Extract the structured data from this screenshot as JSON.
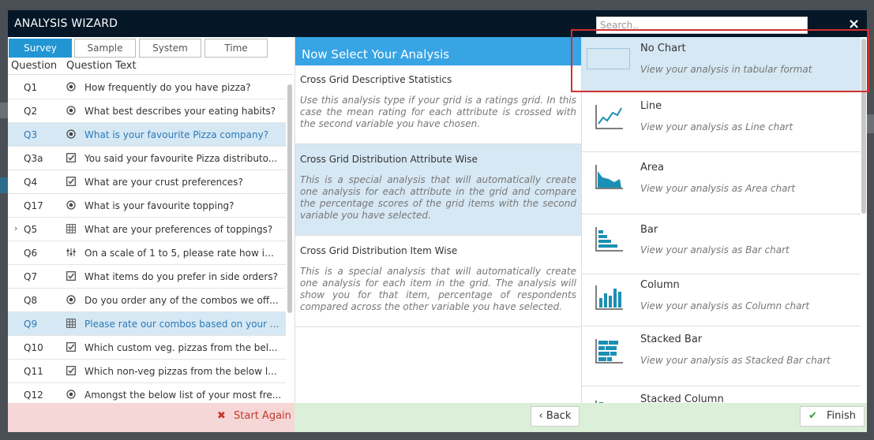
{
  "window": {
    "title": "ANALYSIS WIZARD",
    "close": "×"
  },
  "search": {
    "placeholder": "Search.."
  },
  "tabs": [
    {
      "label": "Survey",
      "active": true
    },
    {
      "label": "Sample",
      "active": false
    },
    {
      "label": "System",
      "active": false
    },
    {
      "label": "Time",
      "active": false
    }
  ],
  "question_list": {
    "headers": {
      "question": "Question",
      "text": "Question Text"
    },
    "rows": [
      {
        "id": "Q1",
        "icon": "radio-icon",
        "text": "How frequently do you have pizza?",
        "selected": false,
        "caret": ""
      },
      {
        "id": "Q2",
        "icon": "radio-icon",
        "text": "What best describes your eating habits?",
        "selected": false,
        "caret": ""
      },
      {
        "id": "Q3",
        "icon": "radio-icon",
        "text": "What is your favourite Pizza company?",
        "selected": true,
        "caret": ""
      },
      {
        "id": "Q3a",
        "icon": "checkbox-icon",
        "text": "You said your favourite Pizza distributo...",
        "selected": false,
        "caret": ""
      },
      {
        "id": "Q4",
        "icon": "checkbox-icon",
        "text": "What are your crust preferences?",
        "selected": false,
        "caret": ""
      },
      {
        "id": "Q17",
        "icon": "radio-icon",
        "text": "What is your favourite topping?",
        "selected": false,
        "caret": ""
      },
      {
        "id": "Q5",
        "icon": "grid-icon",
        "text": "What are your preferences of toppings?",
        "selected": false,
        "caret": "›"
      },
      {
        "id": "Q6",
        "icon": "sliders-icon",
        "text": "On a scale of 1 to 5, please rate how im...",
        "selected": false,
        "caret": ""
      },
      {
        "id": "Q7",
        "icon": "checkbox-icon",
        "text": "What items do you prefer in side orders?",
        "selected": false,
        "caret": ""
      },
      {
        "id": "Q8",
        "icon": "radio-icon",
        "text": "Do you order any of the combos we off...",
        "selected": false,
        "caret": ""
      },
      {
        "id": "Q9",
        "icon": "grid-icon",
        "text": "Please rate our combos based on your ...",
        "selected": true,
        "caret": ""
      },
      {
        "id": "Q10",
        "icon": "checkbox-icon",
        "text": "Which custom veg. pizzas from the bel...",
        "selected": false,
        "caret": ""
      },
      {
        "id": "Q11",
        "icon": "checkbox-icon",
        "text": "Which non-veg pizzas from the below l...",
        "selected": false,
        "caret": ""
      },
      {
        "id": "Q12",
        "icon": "radio-icon",
        "text": "Amongst the below list of your most fre...",
        "selected": false,
        "caret": ""
      }
    ]
  },
  "analysis": {
    "heading": "Now Select Your Analysis",
    "items": [
      {
        "title": "Cross Grid Descriptive Statistics",
        "description": "Use this analysis type if your grid is a ratings grid. In this case the mean rating for each attribute is crossed with the second variable you have chosen.",
        "selected": false
      },
      {
        "title": "Cross Grid Distribution Attribute Wise",
        "description": "This is a special analysis that will automatically create one analysis for each attribute in the grid and compare the percentage scores of the grid items with the second variable you have selected.",
        "selected": true
      },
      {
        "title": "Cross Grid Distribution Item Wise",
        "description": "This is a special analysis that will automatically create one analysis for each item in the grid. The analysis will show you for that item, percentage of respondents compared across the other variable you have selected.",
        "selected": false
      }
    ]
  },
  "charts": [
    {
      "name": "No Chart",
      "description": "View your analysis in tabular format",
      "icon": "no-chart-icon",
      "selected": true
    },
    {
      "name": "Line",
      "description": "View your analysis as Line chart",
      "icon": "line-chart-icon",
      "selected": false
    },
    {
      "name": "Area",
      "description": "View your analysis as Area chart",
      "icon": "area-chart-icon",
      "selected": false
    },
    {
      "name": "Bar",
      "description": "View your analysis as Bar chart",
      "icon": "bar-chart-icon",
      "selected": false
    },
    {
      "name": "Column",
      "description": "View your analysis as Column chart",
      "icon": "column-chart-icon",
      "selected": false
    },
    {
      "name": "Stacked Bar",
      "description": "View your analysis as Stacked Bar chart",
      "icon": "stacked-bar-chart-icon",
      "selected": false
    },
    {
      "name": "Stacked Column",
      "description": "",
      "icon": "stacked-column-chart-icon",
      "selected": false
    }
  ],
  "footer": {
    "start_again": "Start Again",
    "back": "Back",
    "finish": "Finish"
  },
  "colors": {
    "titlebar": "#051727",
    "accent": "#2196d3",
    "selected_row": "#d6e8f4",
    "icon_teal": "#1b8fb5",
    "highlight": "#d32f2f"
  }
}
